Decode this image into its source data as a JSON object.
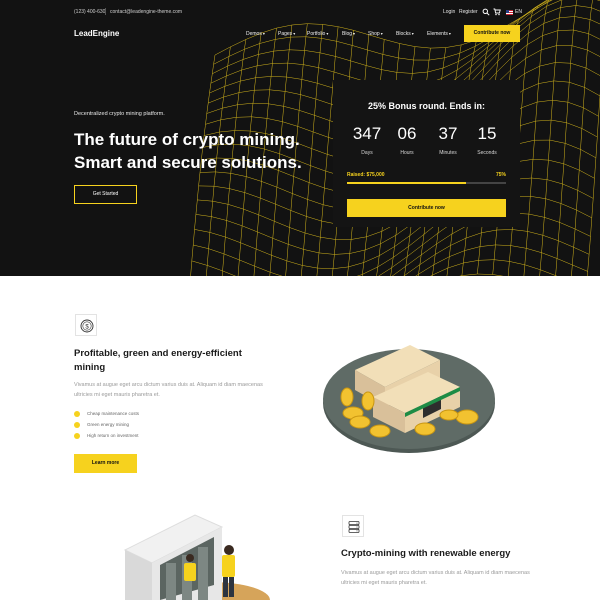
{
  "topbar": {
    "phone": "(123) 400-630",
    "email": "contact@leadengine-theme.com",
    "login": "Login",
    "register": "Register",
    "language": "EN",
    "icons": [
      "search-icon",
      "cart-icon",
      "flag-us-icon"
    ]
  },
  "navbar": {
    "logo": "LeadEngine",
    "items": [
      {
        "label": "Demos"
      },
      {
        "label": "Pages"
      },
      {
        "label": "Portfolio"
      },
      {
        "label": "Blog"
      },
      {
        "label": "Shop"
      },
      {
        "label": "Blocks"
      },
      {
        "label": "Elements"
      }
    ],
    "cta": "Contribute now"
  },
  "hero": {
    "kicker": "Decentralized crypto mining platform.",
    "headline_line1": "The future of crypto mining.",
    "headline_line2": "Smart and secure solutions.",
    "cta": "Get Started"
  },
  "countdown": {
    "title": "25% Bonus round. Ends in:",
    "timers": [
      {
        "value": "347",
        "unit": "Days"
      },
      {
        "value": "06",
        "unit": "Hours"
      },
      {
        "value": "37",
        "unit": "Minutes"
      },
      {
        "value": "15",
        "unit": "Seconds"
      }
    ],
    "raised": "Raised: $75,000",
    "percent_label": "75%",
    "progress": 0.75,
    "cta": "Contribute now"
  },
  "feature1": {
    "icon": "coin-icon",
    "title": "Profitable, green and energy-efficient mining",
    "desc": "Vivamus at augue eget arcu dictum varius duis at. Aliquam id diam maecenas ultricies mi eget mauris pharetra et.",
    "checks": [
      "Cheap maintenance costs",
      "Green energy mining",
      "High return on investment"
    ],
    "cta": "Learn more"
  },
  "feature2": {
    "icon": "server-icon",
    "title": "Crypto-mining with renewable energy",
    "desc": "Vivamus at augue eget arcu dictum varius duis at. Aliquam id diam maecenas ultricies mi eget mauris pharetra et."
  },
  "colors": {
    "accent": "#f6d21e",
    "hero_bg": "#121212",
    "text_dark": "#1a1a1a",
    "text_muted": "#9a9a9a"
  }
}
